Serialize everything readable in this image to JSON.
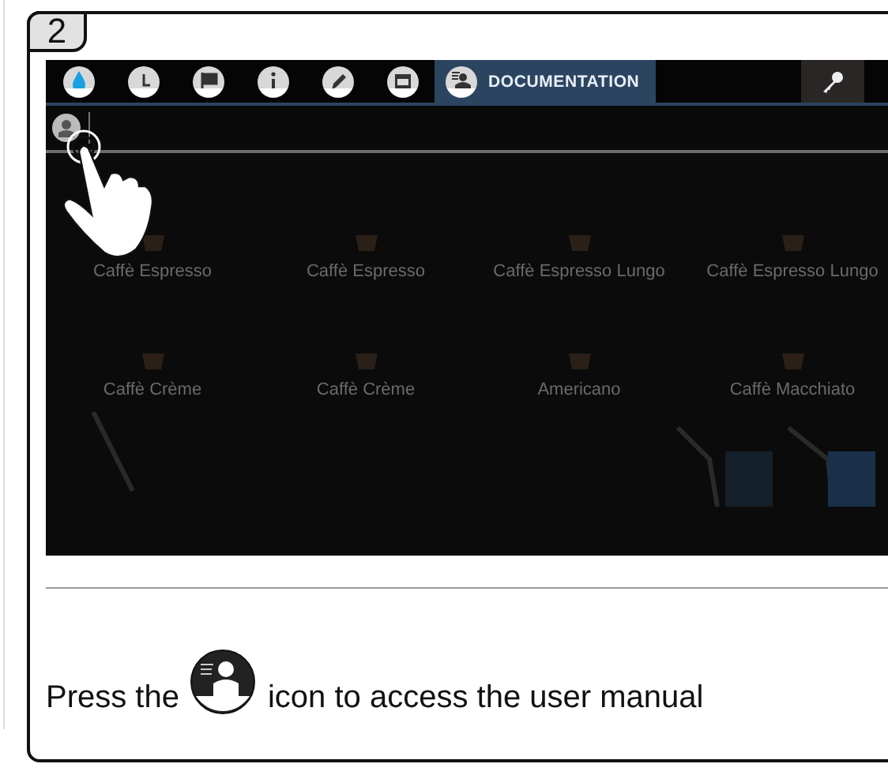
{
  "step": {
    "number": "2"
  },
  "screen": {
    "tabs": [
      {
        "kind": "water",
        "selected": false
      },
      {
        "kind": "clock",
        "selected": false
      },
      {
        "kind": "flag",
        "selected": false
      },
      {
        "kind": "info",
        "selected": false
      },
      {
        "kind": "pencil",
        "selected": false
      },
      {
        "kind": "calendar",
        "selected": false
      },
      {
        "kind": "manual",
        "label": "DOCUMENTATION",
        "selected": true
      }
    ],
    "products": [
      {
        "name": "Caffè Espresso"
      },
      {
        "name": "Caffè Espresso"
      },
      {
        "name": "Caffè Espresso Lungo"
      },
      {
        "name": "Caffè Espresso Lungo"
      },
      {
        "name": "Caffè Crème"
      },
      {
        "name": "Caffè Crème"
      },
      {
        "name": "Americano"
      },
      {
        "name": "Caffè Macchiato"
      }
    ]
  },
  "instruction": {
    "before": "Press the",
    "after": "icon to access the user manual"
  }
}
